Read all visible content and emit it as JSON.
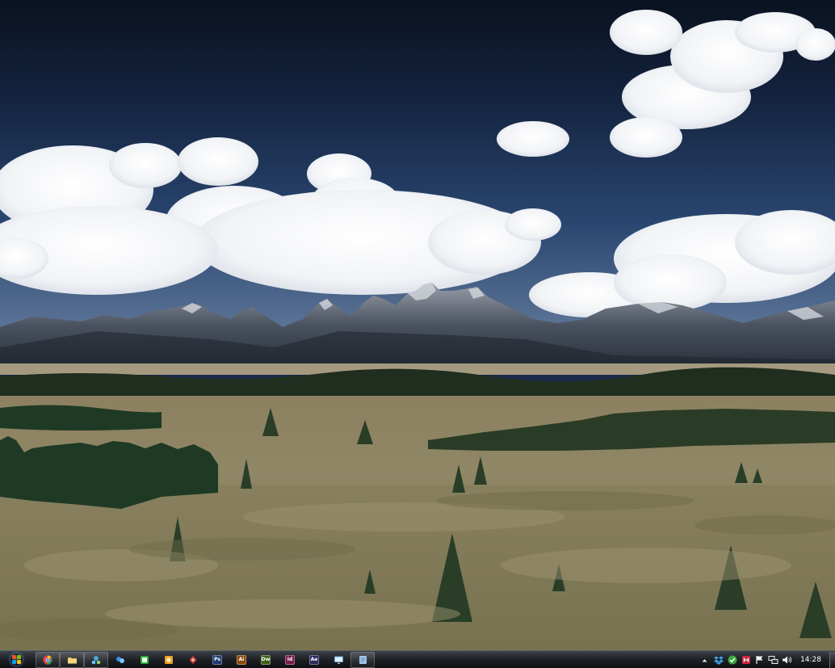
{
  "desktop": {
    "wallpaper": "mountain-landscape-wallpaper"
  },
  "taskbar": {
    "start": {
      "icon": "windows-logo-icon"
    },
    "apps": [
      {
        "name": "chrome",
        "icon": "chrome-icon",
        "glyph": "",
        "color": "#e8453c",
        "open": true
      },
      {
        "name": "explorer",
        "icon": "folder-icon",
        "glyph": "",
        "color": "#e9c45a",
        "open": true
      },
      {
        "name": "network",
        "icon": "network-icon",
        "glyph": "",
        "color": "#4aa3df",
        "open": true
      },
      {
        "name": "messenger",
        "icon": "messenger-icon",
        "glyph": "",
        "color": "#3c8de0",
        "open": false
      },
      {
        "name": "app-green",
        "icon": "green-app-icon",
        "glyph": "",
        "color": "#2faa3f",
        "open": false
      },
      {
        "name": "app-orange",
        "icon": "orange-app-icon",
        "glyph": "",
        "color": "#f0a020",
        "open": false
      },
      {
        "name": "app-red",
        "icon": "red-app-icon",
        "glyph": "",
        "color": "#d8413a",
        "open": false
      },
      {
        "name": "photoshop",
        "icon": "photoshop-icon",
        "glyph": "Ps",
        "color": "#1c3a6e",
        "open": false
      },
      {
        "name": "illustrator",
        "icon": "illustrator-icon",
        "glyph": "Ai",
        "color": "#8a4a08",
        "open": false
      },
      {
        "name": "dreamweaver",
        "icon": "dreamweaver-icon",
        "glyph": "Dw",
        "color": "#3f5d14",
        "open": false
      },
      {
        "name": "indesign",
        "icon": "indesign-icon",
        "glyph": "Id",
        "color": "#7a1a4a",
        "open": false
      },
      {
        "name": "aftereffects",
        "icon": "aftereffects-icon",
        "glyph": "Ae",
        "color": "#2a2a5a",
        "open": false
      },
      {
        "name": "monitor",
        "icon": "monitor-icon",
        "glyph": "",
        "color": "#6aa0d8",
        "open": false
      },
      {
        "name": "notes",
        "icon": "notes-icon",
        "glyph": "",
        "color": "#9fc4e8",
        "open": true
      }
    ]
  },
  "tray": {
    "icons": [
      {
        "name": "show-hidden-icons",
        "icon": "chevron-up-icon"
      },
      {
        "name": "dropbox",
        "icon": "dropbox-icon"
      },
      {
        "name": "sync",
        "icon": "check-sync-icon"
      },
      {
        "name": "app-red",
        "icon": "red-app-tray-icon"
      },
      {
        "name": "action-center",
        "icon": "flag-icon"
      },
      {
        "name": "network",
        "icon": "network-status-icon"
      },
      {
        "name": "volume",
        "icon": "speaker-icon"
      }
    ],
    "clock": "14:28"
  }
}
